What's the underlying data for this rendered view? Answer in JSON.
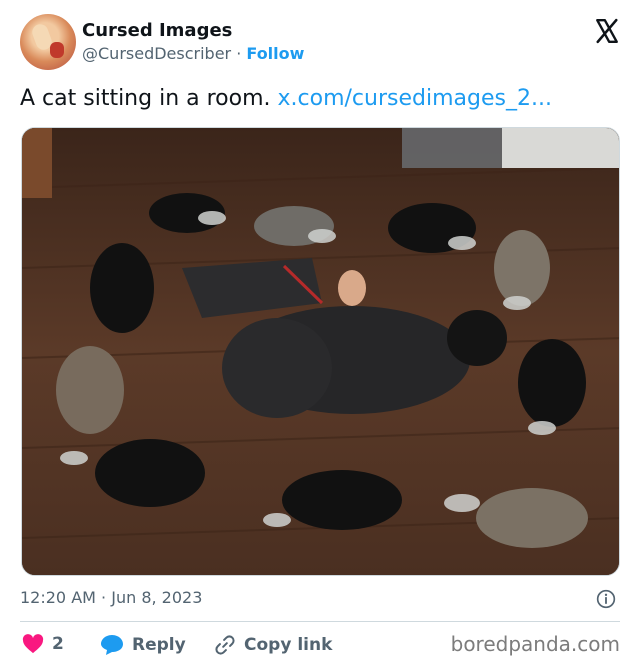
{
  "author": {
    "name": "Cursed Images",
    "handle": "@CursedDescriber",
    "separator": "·",
    "follow_label": "Follow"
  },
  "tweet": {
    "text": "A cat sitting in a room.",
    "link_text": "x.com/cursedimages_2..."
  },
  "meta": {
    "time": "12:20 AM",
    "separator": "·",
    "date": "Jun 8, 2023"
  },
  "actions": {
    "like_count": "2",
    "reply_label": "Reply",
    "copy_link_label": "Copy link"
  },
  "watermark": "boredpanda.com",
  "colors": {
    "accent": "#1d9bf0",
    "like": "#f91880",
    "text": "#0f1419",
    "muted": "#536471",
    "floor": "#5a3a28"
  },
  "icons": [
    "x-logo-icon",
    "info-icon",
    "heart-icon",
    "reply-bubble-icon",
    "link-icon"
  ]
}
